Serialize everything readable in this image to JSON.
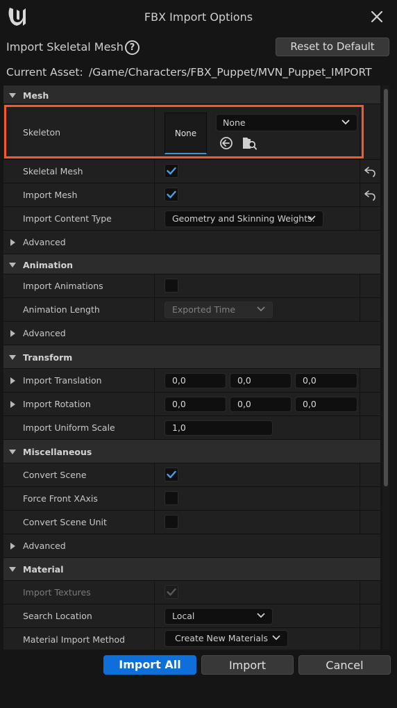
{
  "window": {
    "title": "FBX Import Options"
  },
  "header": {
    "title": "Import Skeletal Mesh",
    "reset_label": "Reset to Default"
  },
  "asset": {
    "label": "Current Asset:",
    "value": "/Game/Characters/FBX_Puppet/MVN_Puppet_IMPORT"
  },
  "mesh": {
    "title": "Mesh",
    "skeleton": {
      "label": "Skeleton",
      "thumb": "None",
      "value": "None"
    },
    "skeletal_mesh": {
      "label": "Skeletal Mesh",
      "checked": true
    },
    "import_mesh": {
      "label": "Import Mesh",
      "checked": true
    },
    "content_type": {
      "label": "Import Content Type",
      "value": "Geometry and Skinning Weights."
    },
    "advanced": "Advanced"
  },
  "animation": {
    "title": "Animation",
    "import_animations": {
      "label": "Import Animations",
      "checked": false
    },
    "length": {
      "label": "Animation Length",
      "value": "Exported Time"
    },
    "advanced": "Advanced"
  },
  "transform": {
    "title": "Transform",
    "translation": {
      "label": "Import Translation",
      "x": "0,0",
      "y": "0,0",
      "z": "0,0"
    },
    "rotation": {
      "label": "Import Rotation",
      "x": "0,0",
      "y": "0,0",
      "z": "0,0"
    },
    "scale": {
      "label": "Import Uniform Scale",
      "value": "1,0"
    }
  },
  "misc": {
    "title": "Miscellaneous",
    "convert_scene": {
      "label": "Convert Scene",
      "checked": true
    },
    "force_front": {
      "label": "Force Front XAxis",
      "checked": false
    },
    "convert_unit": {
      "label": "Convert Scene Unit",
      "checked": false
    },
    "advanced": "Advanced"
  },
  "material": {
    "title": "Material",
    "import_textures": {
      "label": "Import Textures",
      "checked": true
    },
    "search_location": {
      "label": "Search Location",
      "value": "Local"
    },
    "import_method": {
      "label": "Material Import Method",
      "value": "Create New Materials"
    }
  },
  "footer": {
    "import_all": "Import All",
    "import": "Import",
    "cancel": "Cancel"
  },
  "colors": {
    "accent": "#0e6fd8",
    "highlight": "#f25a29",
    "check": "#4a9ee8"
  }
}
